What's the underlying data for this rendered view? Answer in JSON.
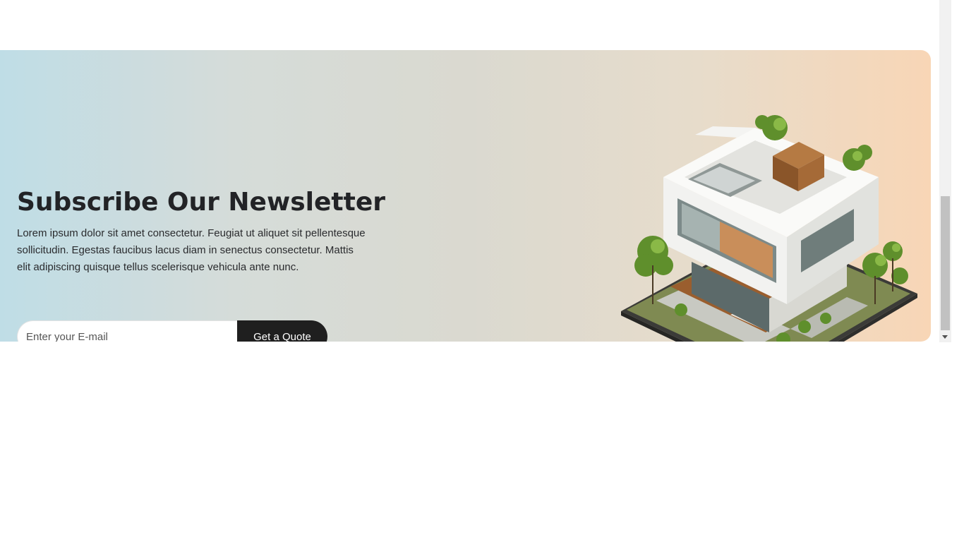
{
  "newsletter": {
    "title": "Subscribe Our Newsletter",
    "description": "Lorem ipsum dolor sit amet consectetur. Feugiat ut aliquet sit pellentesque sollicitudin. Egestas faucibus lacus diam in senectus consectetur. Mattis elit adipiscing quisque tellus scelerisque vehicula ante nunc.",
    "email_placeholder": "Enter your E-mail",
    "email_value": "",
    "button_label": "Get a Quote",
    "image_icon": "house-illustration-icon"
  },
  "colors": {
    "gradient_start": "#bfdde6",
    "gradient_end": "#f8d6b6",
    "button_bg": "#1f1f1f",
    "title_color": "#222326"
  }
}
